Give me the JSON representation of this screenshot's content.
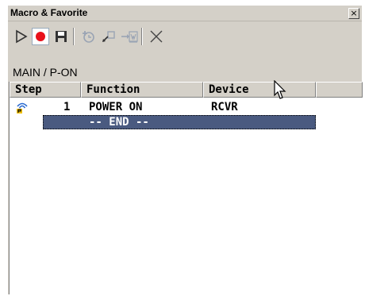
{
  "window": {
    "title": "Macro & Favorite",
    "close_glyph": "×"
  },
  "toolbar": {
    "buttons": [
      {
        "name": "play-icon"
      },
      {
        "name": "record-icon"
      },
      {
        "name": "save-icon"
      },
      {
        "name": "add-step-icon"
      },
      {
        "name": "insert-icon"
      },
      {
        "name": "move-icon"
      },
      {
        "name": "delete-icon"
      }
    ],
    "colors": {
      "record": "#e8101a",
      "icon": "#333333",
      "disabled": "#9aa4b4"
    }
  },
  "path": "MAIN / P-ON",
  "table": {
    "columns": [
      "Step",
      "Function",
      "Device"
    ],
    "rows": [
      {
        "step": "1",
        "function": "POWER ON",
        "device": "RCVR",
        "icon": "remote-signal-icon"
      }
    ],
    "end_label": "-- END --",
    "selection_color": "#4a5a80"
  }
}
